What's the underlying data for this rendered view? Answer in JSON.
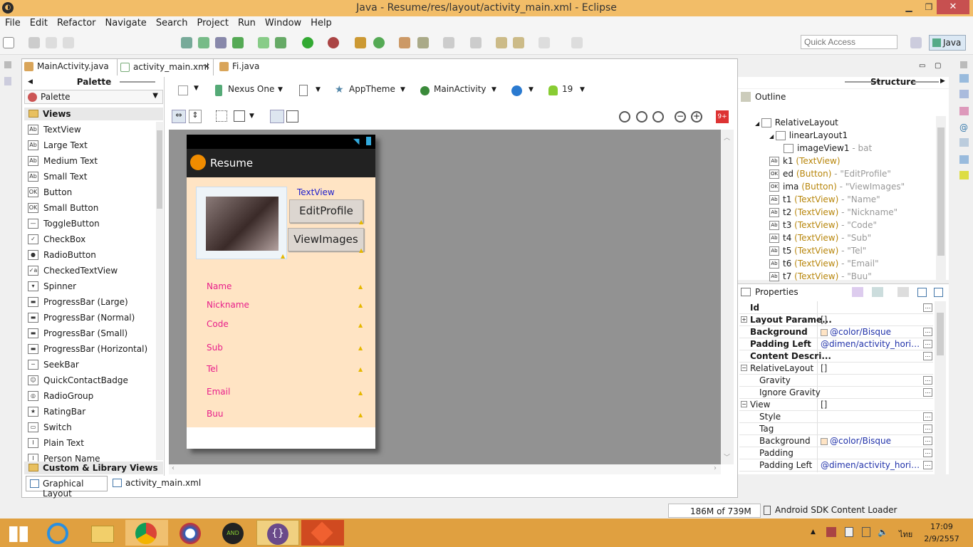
{
  "window": {
    "title": "Java - Resume/res/layout/activity_main.xml - Eclipse"
  },
  "menu": [
    "File",
    "Edit",
    "Refactor",
    "Navigate",
    "Search",
    "Project",
    "Run",
    "Window",
    "Help"
  ],
  "quick_access": {
    "placeholder": "Quick Access"
  },
  "perspective": "Java",
  "tabs": [
    {
      "label": "MainActivity.java"
    },
    {
      "label": "activity_main.xml"
    },
    {
      "label": "Fi.java"
    }
  ],
  "palette": {
    "title": "Palette",
    "selector": "Palette",
    "group_views": "Views",
    "items": [
      "TextView",
      "Large Text",
      "Medium Text",
      "Small Text",
      "Button",
      "Small Button",
      "ToggleButton",
      "CheckBox",
      "RadioButton",
      "CheckedTextView",
      "Spinner",
      "ProgressBar (Large)",
      "ProgressBar (Normal)",
      "ProgressBar (Small)",
      "ProgressBar (Horizontal)",
      "SeekBar",
      "QuickContactBadge",
      "RadioGroup",
      "RatingBar",
      "Switch",
      "Plain Text",
      "Person Name"
    ],
    "group_custom": "Custom & Library Views"
  },
  "config": {
    "device": "Nexus One",
    "theme": "AppTheme",
    "activity": "MainActivity",
    "api": "19",
    "warnings": "9+"
  },
  "device_screen": {
    "app_title": "Resume",
    "textview": "TextView",
    "btn_edit": "EditProfile",
    "btn_view": "ViewImages",
    "fields": [
      "Name",
      "Nickname",
      "Code",
      "Sub",
      "Tel",
      "Email",
      "Buu"
    ]
  },
  "structure": {
    "title": "Structure",
    "outline_title": "Outline"
  },
  "outline": [
    {
      "name": "RelativeLayout",
      "type": "",
      "value": ""
    },
    {
      "name": "linearLayout1",
      "type": "",
      "value": ""
    },
    {
      "name": "imageView1",
      "type": "",
      "value": "- bat"
    },
    {
      "name": "k1",
      "type": "(TextView)",
      "value": ""
    },
    {
      "name": "ed",
      "type": "(Button)",
      "value": "- \"EditProfile\""
    },
    {
      "name": "ima",
      "type": "(Button)",
      "value": "- \"ViewImages\""
    },
    {
      "name": "t1",
      "type": "(TextView)",
      "value": "- \"Name\""
    },
    {
      "name": "t2",
      "type": "(TextView)",
      "value": "- \"Nickname\""
    },
    {
      "name": "t3",
      "type": "(TextView)",
      "value": "- \"Code\""
    },
    {
      "name": "t4",
      "type": "(TextView)",
      "value": "- \"Sub\""
    },
    {
      "name": "t5",
      "type": "(TextView)",
      "value": "- \"Tel\""
    },
    {
      "name": "t6",
      "type": "(TextView)",
      "value": "- \"Email\""
    },
    {
      "name": "t7",
      "type": "(TextView)",
      "value": "- \"Buu\""
    }
  ],
  "properties": {
    "title": "Properties",
    "rows": [
      {
        "key": "Id",
        "value": ""
      },
      {
        "key": "Layout Parame...",
        "value": "[]"
      },
      {
        "key": "Background",
        "value": "@color/Bisque"
      },
      {
        "key": "Padding Left",
        "value": "@dimen/activity_horizon..."
      },
      {
        "key": "Content Descri...",
        "value": ""
      },
      {
        "key": "RelativeLayout",
        "value": "[]"
      },
      {
        "key": "Gravity",
        "value": ""
      },
      {
        "key": "Ignore Gravity",
        "value": ""
      },
      {
        "key": "View",
        "value": "[]"
      },
      {
        "key": "Style",
        "value": ""
      },
      {
        "key": "Tag",
        "value": ""
      },
      {
        "key": "Background",
        "value": "@color/Bisque"
      },
      {
        "key": "Padding",
        "value": ""
      },
      {
        "key": "Padding Left",
        "value": "@dimen/activity_horizon..."
      }
    ]
  },
  "bottom_tabs": [
    "Graphical Layout",
    "activity_main.xml"
  ],
  "status": {
    "memory": "186M of 739M",
    "task": "Android SDK Content Loader"
  },
  "tray": {
    "lang": "ไทย",
    "time": "17:09",
    "date": "2/9/2557"
  }
}
